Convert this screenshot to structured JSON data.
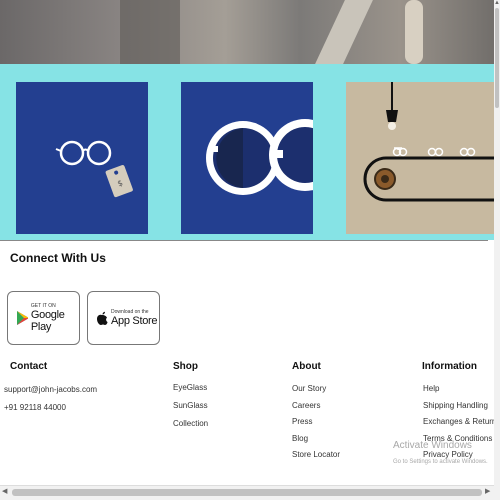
{
  "footer": {
    "connect_title": "Connect With Us",
    "google_play": {
      "small": "GET IT ON",
      "big": "Google Play"
    },
    "app_store": {
      "small": "Download on the",
      "big": "App Store"
    },
    "columns": [
      {
        "heading": "Contact",
        "items": [
          "support@john-jacobs.com",
          "+91 92118 44000"
        ]
      },
      {
        "heading": "Shop",
        "items": [
          "EyeGlass",
          "SunGlass",
          "Collection"
        ]
      },
      {
        "heading": "About",
        "items": [
          "Our Story",
          "Careers",
          "Press",
          "Blog",
          "Store Locator"
        ]
      },
      {
        "heading": "Information",
        "items": [
          "Help",
          "Shipping Handling",
          "Exchanges & Returns",
          "Terms & Conditions",
          "Privacy Policy"
        ]
      }
    ]
  },
  "watermark": {
    "line1": "Activate Windows",
    "line2": "Go to Settings to activate Windows."
  },
  "colors": {
    "teal": "#86e3e5",
    "navy": "#233f90",
    "beige": "#c7b9a0"
  },
  "icons": [
    "glasses-icon",
    "price-tag-icon",
    "sunglasses-icon",
    "lamp-icon",
    "conveyor-icon",
    "google-play-icon",
    "apple-icon"
  ]
}
